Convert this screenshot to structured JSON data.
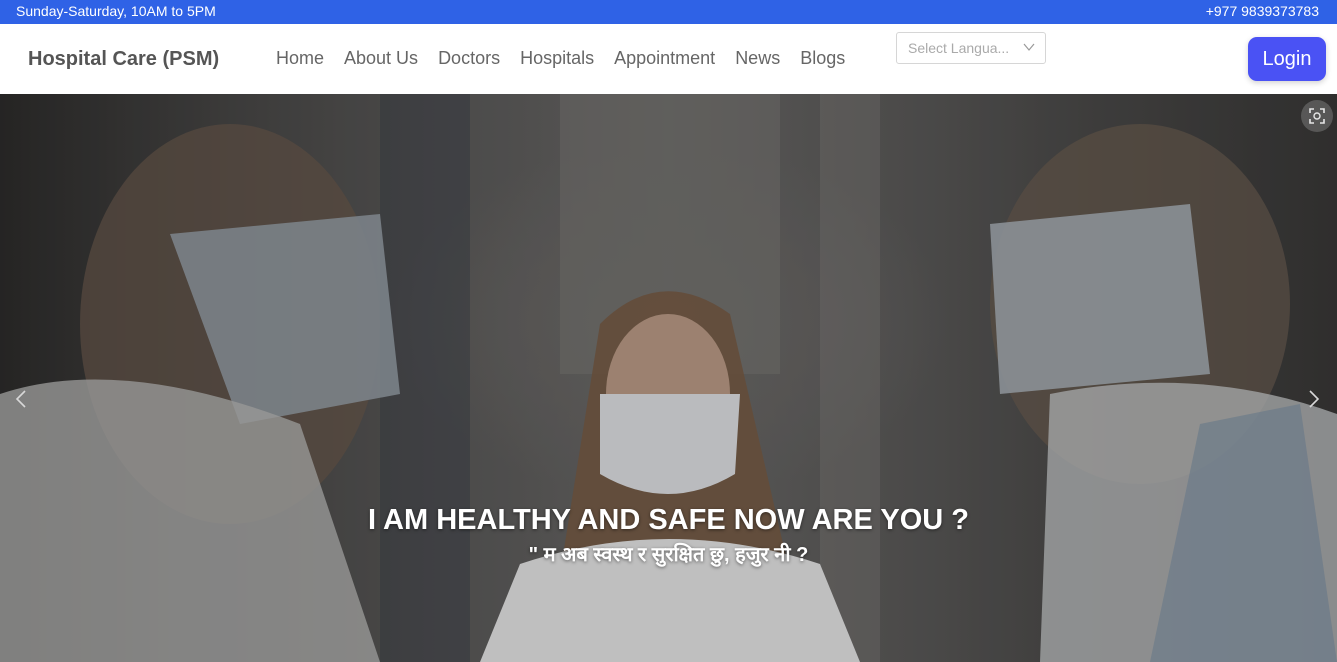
{
  "topbar": {
    "hours": "Sunday-Saturday, 10AM to 5PM",
    "phone": "+977 9839373783"
  },
  "brand": "Hospital Care (PSM)",
  "nav": [
    "Home",
    "About Us",
    "Doctors",
    "Hospitals",
    "Appointment",
    "News",
    "Blogs"
  ],
  "language_select": {
    "placeholder": "Select Langua...",
    "icon": "chevron-down-icon"
  },
  "login_label": "Login",
  "hero": {
    "headline": "I AM HEALTHY AND SAFE NOW ARE YOU ?",
    "subline": "\" म अब स्वस्थ र सुरक्षित छु, हजुर नी ?",
    "icons": [
      "zoom-icon",
      "chevron-left-icon",
      "chevron-right-icon"
    ]
  },
  "colors": {
    "topbar": "#2f62e6",
    "login_button": "#4a52f4",
    "nav_text": "#666666"
  }
}
